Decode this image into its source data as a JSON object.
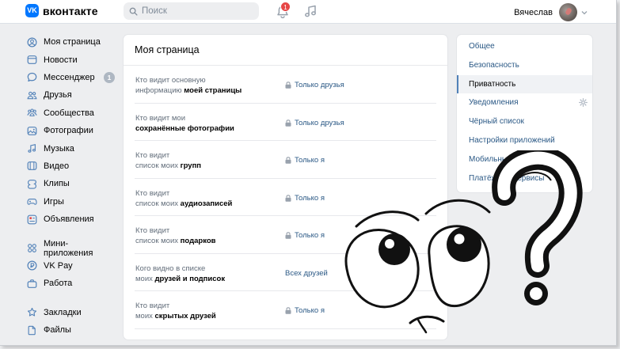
{
  "header": {
    "logo_mark": "VK",
    "logo_text": "вконтакте",
    "search_placeholder": "Поиск",
    "notifications_count": "1",
    "user_name": "Вячеслав"
  },
  "left_nav": {
    "items": [
      {
        "label": "Моя страница",
        "icon": "user-circle-icon"
      },
      {
        "label": "Новости",
        "icon": "news-icon"
      },
      {
        "label": "Мессенджер",
        "icon": "message-icon",
        "badge": "1"
      },
      {
        "label": "Друзья",
        "icon": "friends-icon"
      },
      {
        "label": "Сообщества",
        "icon": "communities-icon"
      },
      {
        "label": "Фотографии",
        "icon": "photo-icon"
      },
      {
        "label": "Музыка",
        "icon": "music-icon"
      },
      {
        "label": "Видео",
        "icon": "video-icon"
      },
      {
        "label": "Клипы",
        "icon": "clips-icon"
      },
      {
        "label": "Игры",
        "icon": "gamepad-icon"
      },
      {
        "label": "Объявления",
        "icon": "classifieds-icon"
      }
    ],
    "items2": [
      {
        "label": "Мини-приложения",
        "icon": "apps-icon"
      },
      {
        "label": "VK Pay",
        "icon": "vkpay-icon"
      },
      {
        "label": "Работа",
        "icon": "briefcase-icon"
      }
    ],
    "items3": [
      {
        "label": "Закладки",
        "icon": "star-icon"
      },
      {
        "label": "Файлы",
        "icon": "file-icon"
      }
    ]
  },
  "main": {
    "title": "Моя страница",
    "rows": [
      {
        "line1": "Кто видит основную",
        "line2_plain": "информацию ",
        "line2_bold": "моей страницы",
        "value": "Только друзья",
        "locked": true
      },
      {
        "line1": "Кто видит мои",
        "line2_plain": "",
        "line2_bold": "сохранённые фотографии",
        "value": "Только друзья",
        "locked": true
      },
      {
        "line1": "Кто видит",
        "line2_plain": "список моих ",
        "line2_bold": "групп",
        "value": "Только я",
        "locked": true
      },
      {
        "line1": "Кто видит",
        "line2_plain": "список моих ",
        "line2_bold": "аудиозаписей",
        "value": "Только я",
        "locked": true
      },
      {
        "line1": "Кто видит",
        "line2_plain": "список моих ",
        "line2_bold": "подарков",
        "value": "Только я",
        "locked": true
      },
      {
        "line1": "Кого видно в списке",
        "line2_plain": "моих ",
        "line2_bold": "друзей и подписок",
        "value": "Всех друзей",
        "locked": false
      },
      {
        "line1": "Кто видит",
        "line2_plain": "моих ",
        "line2_bold": "скрытых друзей",
        "value": "Только я",
        "locked": true
      }
    ]
  },
  "right_menu": {
    "items": [
      {
        "label": "Общее"
      },
      {
        "label": "Безопасность"
      },
      {
        "label": "Приватность",
        "active": true
      },
      {
        "label": "Уведомления",
        "gear": true
      },
      {
        "label": "Чёрный список"
      },
      {
        "label": "Настройки приложений"
      },
      {
        "label": "Мобильные сервисы"
      },
      {
        "label": "Платёжные сервисы"
      }
    ]
  },
  "colors": {
    "brand": "#0077ff",
    "link": "#2a5885",
    "background": "#edeef0",
    "badge_red": "#e64646"
  }
}
